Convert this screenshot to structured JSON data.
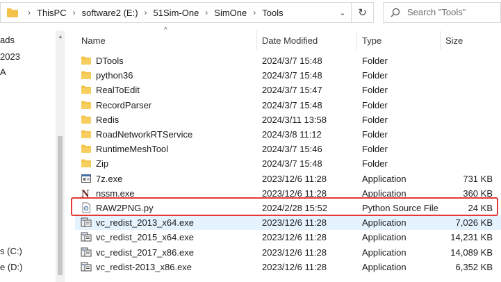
{
  "breadcrumb": [
    "ThisPC",
    "software2 (E:)",
    "51Sim-One",
    "SimOne",
    "Tools"
  ],
  "search": {
    "placeholder": "Search \"Tools\""
  },
  "nav": {
    "items": [
      "ads",
      "2023",
      "A",
      "s (C:)",
      "e (D:)"
    ]
  },
  "columns": {
    "name": "Name",
    "date": "Date Modified",
    "type": "Type",
    "size": "Size"
  },
  "files": [
    {
      "name": "DTools",
      "date": "2024/3/7 15:48",
      "type": "Folder",
      "size": "",
      "icon": "folder-icon"
    },
    {
      "name": "python36",
      "date": "2024/3/7 15:48",
      "type": "Folder",
      "size": "",
      "icon": "folder-icon"
    },
    {
      "name": "RealToEdit",
      "date": "2024/3/7 15:47",
      "type": "Folder",
      "size": "",
      "icon": "folder-icon"
    },
    {
      "name": "RecordParser",
      "date": "2024/3/7 15:48",
      "type": "Folder",
      "size": "",
      "icon": "folder-icon"
    },
    {
      "name": "Redis",
      "date": "2024/3/11 13:58",
      "type": "Folder",
      "size": "",
      "icon": "folder-icon"
    },
    {
      "name": "RoadNetworkRTService",
      "date": "2024/3/8 11:12",
      "type": "Folder",
      "size": "",
      "icon": "folder-icon"
    },
    {
      "name": "RuntimeMeshTool",
      "date": "2024/3/7 15:46",
      "type": "Folder",
      "size": "",
      "icon": "folder-icon"
    },
    {
      "name": "Zip",
      "date": "2024/3/7 15:48",
      "type": "Folder",
      "size": "",
      "icon": "folder-icon"
    },
    {
      "name": "7z.exe",
      "date": "2023/12/6 11:28",
      "type": "Application",
      "size": "731 KB",
      "icon": "app-window-icon"
    },
    {
      "name": "nssm.exe",
      "date": "2023/12/6 11:28",
      "type": "Application",
      "size": "360 KB",
      "icon": "nssm-n-icon"
    },
    {
      "name": "RAW2PNG.py",
      "date": "2024/2/28 15:52",
      "type": "Python Source File",
      "size": "24 KB",
      "icon": "python-file-icon"
    },
    {
      "name": "vc_redist_2013_x64.exe",
      "date": "2023/12/6 11:28",
      "type": "Application",
      "size": "7,026 KB",
      "icon": "installer-icon"
    },
    {
      "name": "vc_redist_2015_x64.exe",
      "date": "2023/12/6 11:28",
      "type": "Application",
      "size": "14,231 KB",
      "icon": "installer-icon"
    },
    {
      "name": "vc_redist_2017_x86.exe",
      "date": "2023/12/6 11:28",
      "type": "Application",
      "size": "14,089 KB",
      "icon": "installer-icon"
    },
    {
      "name": "vc_redist-2013_x86.exe",
      "date": "2023/12/6 11:28",
      "type": "Application",
      "size": "6,352 KB",
      "icon": "installer-icon"
    }
  ],
  "colors": {
    "highlight": "#e53935",
    "folder": "#f3c24b",
    "hover": "#e5f3ff"
  }
}
